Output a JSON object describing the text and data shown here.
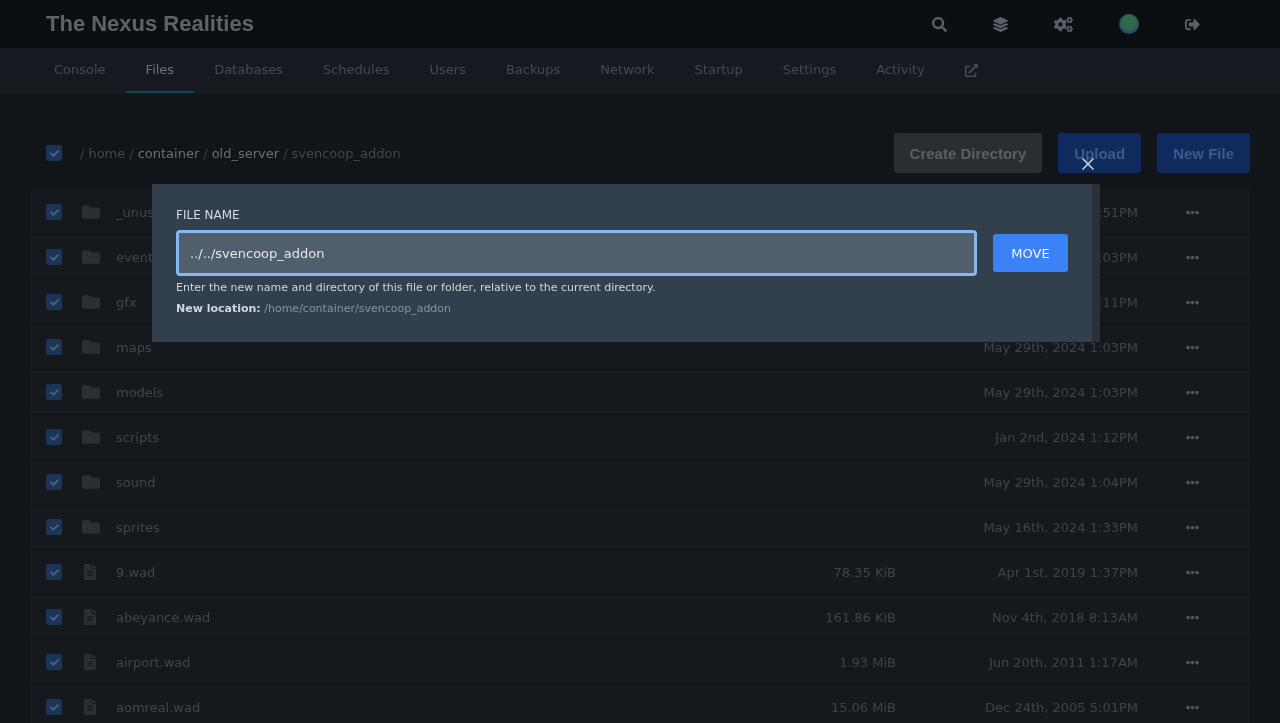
{
  "header": {
    "title": "The Nexus Realities"
  },
  "nav": [
    {
      "label": "Console",
      "selected": false
    },
    {
      "label": "Files",
      "selected": true
    },
    {
      "label": "Databases",
      "selected": false
    },
    {
      "label": "Schedules",
      "selected": false
    },
    {
      "label": "Users",
      "selected": false
    },
    {
      "label": "Backups",
      "selected": false
    },
    {
      "label": "Network",
      "selected": false
    },
    {
      "label": "Startup",
      "selected": false
    },
    {
      "label": "Settings",
      "selected": false
    },
    {
      "label": "Activity",
      "selected": false
    }
  ],
  "breadcrumb": {
    "checked": true,
    "separator": "/",
    "segments": [
      {
        "label": "home",
        "link": false
      },
      {
        "label": "container",
        "link": true
      },
      {
        "label": "old_server",
        "link": true
      },
      {
        "label": "svencoop_addon",
        "link": false
      }
    ]
  },
  "actions": [
    {
      "label": "Create Directory",
      "kind": "secondary"
    },
    {
      "label": "Upload",
      "kind": "primary"
    },
    {
      "label": "New File",
      "kind": "primary"
    }
  ],
  "files": [
    {
      "name": "_unus",
      "kind": "folder",
      "modified": ":51PM",
      "checked": true
    },
    {
      "name": "event",
      "kind": "folder",
      "modified": ":03PM",
      "checked": true
    },
    {
      "name": "gfx",
      "kind": "folder",
      "modified": ":11PM",
      "checked": true
    },
    {
      "name": "maps",
      "kind": "folder",
      "modified": "May 29th, 2024 1:03PM",
      "checked": true
    },
    {
      "name": "models",
      "kind": "folder",
      "modified": "May 29th, 2024 1:03PM",
      "checked": true
    },
    {
      "name": "scripts",
      "kind": "folder",
      "modified": "Jan 2nd, 2024 1:12PM",
      "checked": true
    },
    {
      "name": "sound",
      "kind": "folder",
      "modified": "May 29th, 2024 1:04PM",
      "checked": true
    },
    {
      "name": "sprites",
      "kind": "folder",
      "modified": "May 16th, 2024 1:33PM",
      "checked": true
    },
    {
      "name": "9.wad",
      "kind": "file",
      "size": "78.35 KiB",
      "modified": "Apr 1st, 2019 1:37PM",
      "checked": true
    },
    {
      "name": "abeyance.wad",
      "kind": "file",
      "size": "161.86 KiB",
      "modified": "Nov 4th, 2018 8:13AM",
      "checked": true
    },
    {
      "name": "airport.wad",
      "kind": "file",
      "size": "1.93 MiB",
      "modified": "Jun 20th, 2011 1:17AM",
      "checked": true
    },
    {
      "name": "aomreal.wad",
      "kind": "file",
      "size": "15.06 MiB",
      "modified": "Dec 24th, 2005 5:01PM",
      "checked": true
    }
  ],
  "modal": {
    "label": "FILE NAME",
    "value": "../../svencoop_addon",
    "button": "MOVE",
    "help": "Enter the new name and directory of this file or folder, relative to the current directory.",
    "location": "**New location:** /home/container/svencoop_addon"
  }
}
